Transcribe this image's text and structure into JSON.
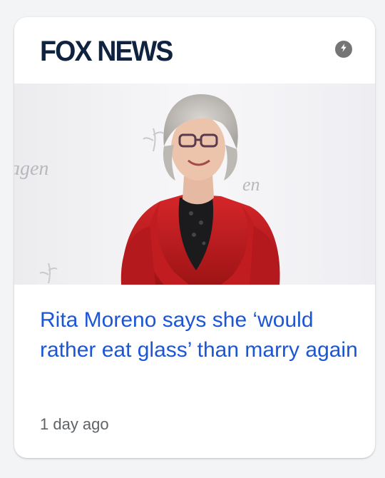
{
  "card": {
    "source_name": "FOX NEWS",
    "amp_icon": "lightning-bolt-icon",
    "image_alt": "Rita Moreno in a red jacket and glasses at an event",
    "headline": "Rita Moreno says she ‘would rather eat glass’ than marry again",
    "timestamp": "1 day ago"
  },
  "colors": {
    "headline": "#1a56d6",
    "logo": "#0f2240",
    "badge": "#757575"
  }
}
